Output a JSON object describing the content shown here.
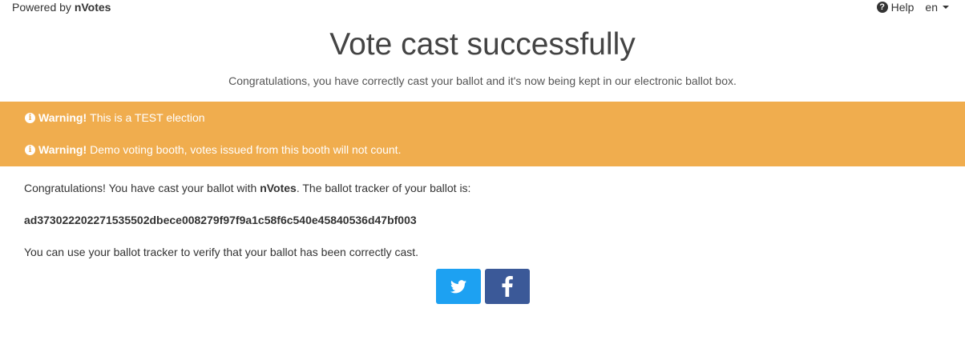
{
  "topbar": {
    "powered_prefix": "Powered by",
    "powered_brand": "nVotes",
    "help_label": "Help",
    "language": "en"
  },
  "header": {
    "title": "Vote cast successfully",
    "subtitle": "Congratulations, you have correctly cast your ballot and it's now being kept in our electronic ballot box."
  },
  "warnings": [
    {
      "strong": "Warning!",
      "text": "This is a TEST election"
    },
    {
      "strong": "Warning!",
      "text": "Demo voting booth, votes issued from this booth will not count."
    }
  ],
  "body": {
    "congrats_prefix": "Congratulations! You have cast your ballot with",
    "congrats_brand": "nVotes",
    "congrats_suffix": ". The ballot tracker of your ballot is:",
    "ballot_tracker": "ad373022202271535502dbece008279f97f9a1c58f6c540e45840536d47bf003",
    "verify_text": "You can use your ballot tracker to verify that your ballot has been correctly cast."
  },
  "share": [
    {
      "name": "twitter",
      "icon": "twitter-icon",
      "color": "#1da1f2"
    },
    {
      "name": "facebook",
      "icon": "facebook-icon",
      "color": "#3b5998"
    }
  ],
  "colors": {
    "warning_bg": "#f0ad4e",
    "text": "#333333"
  }
}
